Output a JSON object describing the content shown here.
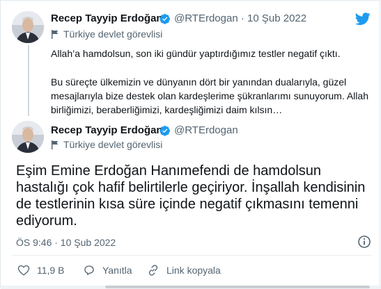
{
  "brand": {
    "accent": "#1d9bf0",
    "text_secondary": "#536471",
    "icon": "twitter-bird-icon"
  },
  "reply_tweet": {
    "name": "Recep Tayyip Erdoğan",
    "handle": "@RTErdogan",
    "separator": "·",
    "date": "10 Şub 2022",
    "label": "Türkiye devlet görevlisi",
    "text_line1": "Allah’a hamdolsun, son iki gündür yaptırdığımız testler negatif çıktı.",
    "text_line2": "Bu süreçte ülkemizin ve dünyanın dört bir yanından dualarıyla, güzel mesajlarıyla bize destek olan kardeşlerime şükranlarımı sunuyorum. Allah birliğimizi, beraberliğimizi, kardeşliğimizi daim kılsın…"
  },
  "main_tweet": {
    "name": "Recep Tayyip Erdoğan",
    "handle": "@RTErdogan",
    "label": "Türkiye devlet görevlisi",
    "text": "Eşim Emine Erdoğan Hanımefendi de hamdolsun hastalığı çok hafif belirtilerle geçiriyor. İnşallah kendisinin de testlerinin kısa süre içinde negatif çıkmasını temenni ediyorum.",
    "time": "ÖS 9:46 · 10 Şub 2022"
  },
  "actions": {
    "likes": "11,9 B",
    "reply": "Yanıtla",
    "copy_link": "Link kopyala"
  }
}
